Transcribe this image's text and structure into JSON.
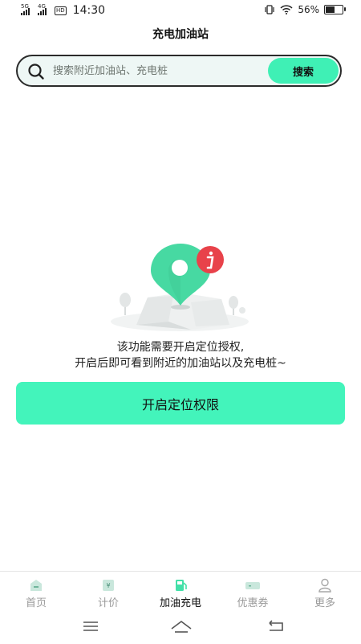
{
  "status_bar": {
    "sim1": "5G",
    "sim2": "4G",
    "hd": "HD",
    "time": "14:30",
    "battery": "56%",
    "battery_level": 0.56
  },
  "header": {
    "title": "充电加油站"
  },
  "search": {
    "placeholder": "搜索附近加油站、充电桩",
    "button_label": "搜索"
  },
  "permission": {
    "message_line1": "该功能需要开启定位授权,",
    "message_line2": "开启后即可看到附近的加油站以及充电桩~",
    "button_label": "开启定位权限",
    "illustration_icon": "location-pin-info"
  },
  "bottom_nav": {
    "items": [
      {
        "label": "首页",
        "icon": "home-icon",
        "active": false
      },
      {
        "label": "计价",
        "icon": "pricing-icon",
        "active": false
      },
      {
        "label": "加油充电",
        "icon": "fuel-icon",
        "active": true
      },
      {
        "label": "优惠券",
        "icon": "coupon-icon",
        "active": false
      },
      {
        "label": "更多",
        "icon": "user-icon",
        "active": false
      }
    ]
  },
  "colors": {
    "accent": "#43f4bb",
    "alert": "#e8424a",
    "inactive": "#9a9a9a"
  }
}
